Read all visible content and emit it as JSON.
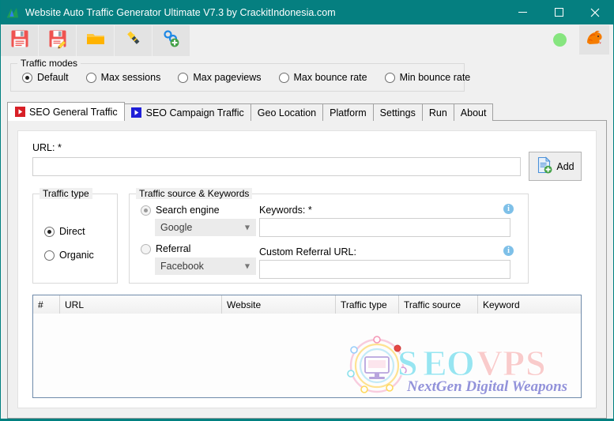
{
  "window": {
    "title": "Website Auto Traffic Generator Ultimate V7.3 by CrackitIndonesia.com",
    "app_icon": "bar-chart-icon",
    "titlebar_color": "#057f80",
    "controls": {
      "minimize": "–",
      "maximize": "□",
      "close": "✕"
    }
  },
  "toolbar": {
    "buttons": [
      {
        "name": "save-icon",
        "tip": "Save"
      },
      {
        "name": "save-as-icon",
        "tip": "Save As"
      },
      {
        "name": "open-folder-icon",
        "tip": "Open"
      },
      {
        "name": "flashlight-icon",
        "tip": "Tools"
      },
      {
        "name": "add-link-icon",
        "tip": "Add Link"
      }
    ],
    "status_dot_color": "#86e57f",
    "dragon_icon": "dragon-icon"
  },
  "traffic_modes": {
    "title": "Traffic modes",
    "options": [
      {
        "label": "Default",
        "checked": true
      },
      {
        "label": "Max sessions",
        "checked": false
      },
      {
        "label": "Max pageviews",
        "checked": false
      },
      {
        "label": "Max bounce rate",
        "checked": false
      },
      {
        "label": "Min bounce rate",
        "checked": false
      }
    ]
  },
  "tabs": [
    {
      "label": "SEO General Traffic",
      "icon": "play-icon",
      "icon_color": "#d81f26",
      "active": true
    },
    {
      "label": "SEO Campaign Traffic",
      "icon": "play-icon",
      "icon_color": "#1f1fd8",
      "active": false
    },
    {
      "label": "Geo Location",
      "icon": null,
      "active": false
    },
    {
      "label": "Platform",
      "icon": null,
      "active": false
    },
    {
      "label": "Settings",
      "icon": null,
      "active": false
    },
    {
      "label": "Run",
      "icon": null,
      "active": false
    },
    {
      "label": "About",
      "icon": null,
      "active": false
    }
  ],
  "general_traffic": {
    "url": {
      "label": "URL: *",
      "value": "",
      "placeholder": ""
    },
    "add_button": {
      "label": "Add",
      "icon": "document-add-icon"
    },
    "traffic_type": {
      "title": "Traffic type",
      "options": [
        {
          "label": "Direct",
          "checked": true
        },
        {
          "label": "Organic",
          "checked": false
        }
      ]
    },
    "traffic_source": {
      "title": "Traffic source & Keywords",
      "options": [
        {
          "label": "Search engine",
          "checked": true,
          "combo_value": "Google"
        },
        {
          "label": "Referral",
          "checked": false,
          "combo_value": "Facebook"
        }
      ],
      "keywords": {
        "label": "Keywords: *",
        "value": "",
        "info": "i"
      },
      "custom_referral": {
        "label": "Custom Referral URL:",
        "value": "",
        "info": "i"
      }
    },
    "grid": {
      "columns": [
        "#",
        "URL",
        "Website",
        "Traffic type",
        "Traffic source",
        "Keyword"
      ],
      "rows": []
    }
  },
  "watermark": {
    "brand": "SEOVPS",
    "tagline": "NextGen Digital Weapons"
  }
}
